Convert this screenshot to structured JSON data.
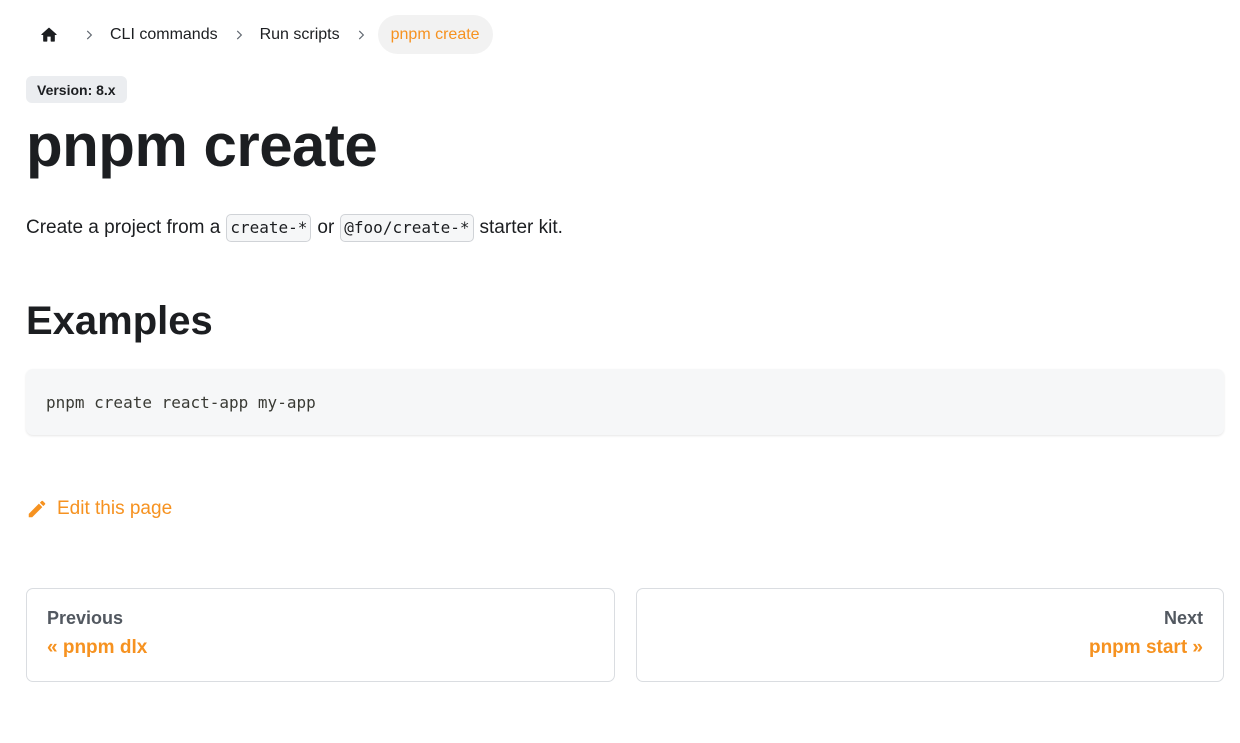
{
  "breadcrumbs": {
    "home_icon": "home-icon",
    "items": [
      "CLI commands",
      "Run scripts"
    ],
    "active": "pnpm create"
  },
  "badge": "Version: 8.x",
  "title": "pnpm create",
  "lead": {
    "before": "Create a project from a",
    "code1": "create-*",
    "middle": "or",
    "code2": "@foo/create-*",
    "after": "starter kit."
  },
  "examples_heading": "Examples",
  "code_example": "pnpm create react-app my-app",
  "edit_link": "Edit this page",
  "pager": {
    "previous": {
      "sub": "Previous",
      "label": "« pnpm dlx"
    },
    "next": {
      "sub": "Next",
      "label": "pnpm start »"
    }
  },
  "colors": {
    "accent": "#f69220",
    "text": "#1c1e21",
    "muted": "#525860",
    "code_bg": "#f6f7f8"
  }
}
